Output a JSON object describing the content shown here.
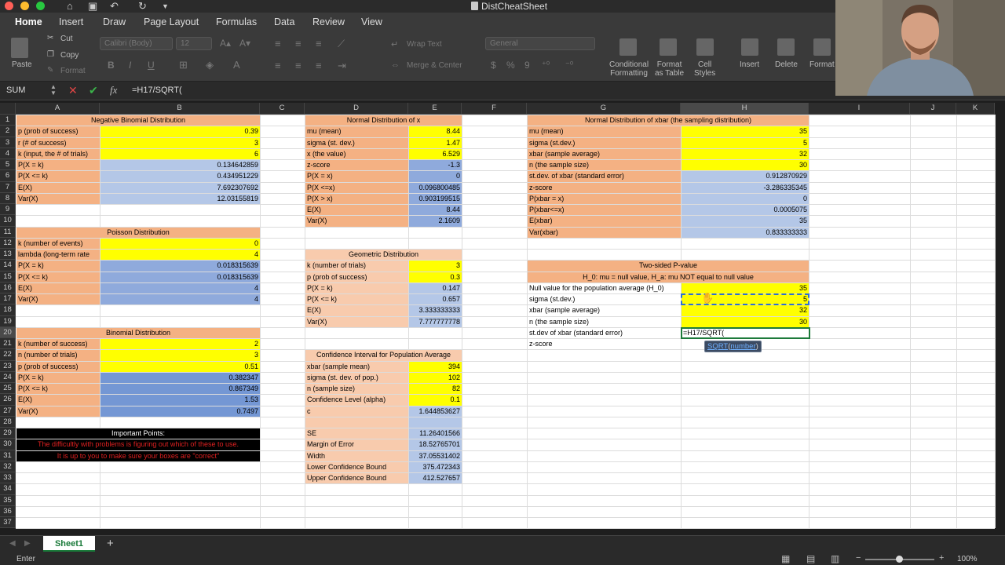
{
  "window": {
    "title": "DistCheatSheet"
  },
  "ribbon_tabs": [
    "Home",
    "Insert",
    "Draw",
    "Page Layout",
    "Formulas",
    "Data",
    "Review",
    "View"
  ],
  "ribbon": {
    "paste": "Paste",
    "cut": "Cut",
    "copy": "Copy",
    "format": "Format",
    "font_name": "Calibri (Body)",
    "font_size": "12",
    "wrap_text": "Wrap Text",
    "merge_center": "Merge & Center",
    "number_format": "General",
    "currency": "$",
    "percent": "%",
    "comma": "9",
    "cond_format": [
      "Conditional",
      "Formatting"
    ],
    "format_table": [
      "Format",
      "as Table"
    ],
    "cell_styles": [
      "Cell",
      "Styles"
    ],
    "insert": "Insert",
    "delete": "Delete",
    "format2": "Format"
  },
  "formula_bar": {
    "name_box": "SUM",
    "fx": "fx",
    "formula": "=H17/SQRT("
  },
  "columns": [
    "A",
    "B",
    "C",
    "D",
    "E",
    "F",
    "G",
    "H",
    "I",
    "J",
    "K"
  ],
  "rows": [
    "1",
    "2",
    "3",
    "4",
    "5",
    "6",
    "7",
    "8",
    "9",
    "10",
    "11",
    "12",
    "13",
    "14",
    "15",
    "16",
    "17",
    "18",
    "19",
    "20",
    "21",
    "22",
    "23",
    "24",
    "25",
    "26",
    "27",
    "28",
    "29",
    "30",
    "31",
    "32",
    "33",
    "34",
    "35",
    "36",
    "37"
  ],
  "cells": [
    {
      "c": "A",
      "c2": "B",
      "r": 1,
      "t": "Negative Binomial Distribution",
      "bg": "#f4b183",
      "al": "c"
    },
    {
      "c": "A",
      "r": 2,
      "t": "p (prob of success)",
      "bg": "#f4b183"
    },
    {
      "c": "B",
      "r": 2,
      "t": "0.39",
      "bg": "#ffff00",
      "al": "r"
    },
    {
      "c": "A",
      "r": 3,
      "t": "r (# of success)",
      "bg": "#f4b183"
    },
    {
      "c": "B",
      "r": 3,
      "t": "3",
      "bg": "#ffff00",
      "al": "r"
    },
    {
      "c": "A",
      "r": 4,
      "t": "k (input, the # of trials)",
      "bg": "#f4b183"
    },
    {
      "c": "B",
      "r": 4,
      "t": "6",
      "bg": "#ffff00",
      "al": "r"
    },
    {
      "c": "A",
      "r": 5,
      "t": "P(X = k)",
      "bg": "#f4b183"
    },
    {
      "c": "B",
      "r": 5,
      "t": "0.134642859",
      "bg": "#b4c7e7",
      "al": "r"
    },
    {
      "c": "A",
      "r": 6,
      "t": "P(X <= k)",
      "bg": "#f4b183"
    },
    {
      "c": "B",
      "r": 6,
      "t": "0.434951229",
      "bg": "#b4c7e7",
      "al": "r"
    },
    {
      "c": "A",
      "r": 7,
      "t": "E(X)",
      "bg": "#f4b183"
    },
    {
      "c": "B",
      "r": 7,
      "t": "7.692307692",
      "bg": "#b4c7e7",
      "al": "r"
    },
    {
      "c": "A",
      "r": 8,
      "t": "Var(X)",
      "bg": "#f4b183"
    },
    {
      "c": "B",
      "r": 8,
      "t": "12.03155819",
      "bg": "#b4c7e7",
      "al": "r"
    },
    {
      "c": "A",
      "c2": "B",
      "r": 11,
      "t": "Poisson Distribution",
      "bg": "#f4b183",
      "al": "c"
    },
    {
      "c": "A",
      "r": 12,
      "t": "k (number of events)",
      "bg": "#f4b183"
    },
    {
      "c": "B",
      "r": 12,
      "t": "0",
      "bg": "#ffff00",
      "al": "r"
    },
    {
      "c": "A",
      "r": 13,
      "t": "lambda (long-term rate",
      "bg": "#f4b183"
    },
    {
      "c": "B",
      "r": 13,
      "t": "4",
      "bg": "#ffff00",
      "al": "r"
    },
    {
      "c": "A",
      "r": 14,
      "t": "P(X = k)",
      "bg": "#f4b183"
    },
    {
      "c": "B",
      "r": 14,
      "t": "0.018315639",
      "bg": "#8faadc",
      "al": "r"
    },
    {
      "c": "A",
      "r": 15,
      "t": "P(X <= k)",
      "bg": "#f4b183"
    },
    {
      "c": "B",
      "r": 15,
      "t": "0.018315639",
      "bg": "#8faadc",
      "al": "r"
    },
    {
      "c": "A",
      "r": 16,
      "t": "E(X)",
      "bg": "#f4b183"
    },
    {
      "c": "B",
      "r": 16,
      "t": "4",
      "bg": "#8faadc",
      "al": "r"
    },
    {
      "c": "A",
      "r": 17,
      "t": "Var(X)",
      "bg": "#f4b183"
    },
    {
      "c": "B",
      "r": 17,
      "t": "4",
      "bg": "#8faadc",
      "al": "r"
    },
    {
      "c": "A",
      "c2": "B",
      "r": 20,
      "t": "Binomial Distribution",
      "bg": "#f4b183",
      "al": "c"
    },
    {
      "c": "A",
      "r": 21,
      "t": "k (number of success)",
      "bg": "#f4b183"
    },
    {
      "c": "B",
      "r": 21,
      "t": "2",
      "bg": "#ffff00",
      "al": "r"
    },
    {
      "c": "A",
      "r": 22,
      "t": "n (number of trials)",
      "bg": "#f4b183"
    },
    {
      "c": "B",
      "r": 22,
      "t": "3",
      "bg": "#ffff00",
      "al": "r"
    },
    {
      "c": "A",
      "r": 23,
      "t": "p (prob of success)",
      "bg": "#f4b183"
    },
    {
      "c": "B",
      "r": 23,
      "t": "0.51",
      "bg": "#ffff00",
      "al": "r"
    },
    {
      "c": "A",
      "r": 24,
      "t": "P(X = k)",
      "bg": "#f4b183"
    },
    {
      "c": "B",
      "r": 24,
      "t": "0.382347",
      "bg": "#7497d4",
      "al": "r"
    },
    {
      "c": "A",
      "r": 25,
      "t": "P(X <= k)",
      "bg": "#f4b183"
    },
    {
      "c": "B",
      "r": 25,
      "t": "0.867349",
      "bg": "#7497d4",
      "al": "r"
    },
    {
      "c": "A",
      "r": 26,
      "t": "E(X)",
      "bg": "#f4b183"
    },
    {
      "c": "B",
      "r": 26,
      "t": "1.53",
      "bg": "#7497d4",
      "al": "r"
    },
    {
      "c": "A",
      "r": 27,
      "t": "Var(X)",
      "bg": "#f4b183"
    },
    {
      "c": "B",
      "r": 27,
      "t": "0.7497",
      "bg": "#7497d4",
      "al": "r"
    },
    {
      "c": "A",
      "c2": "B",
      "r": 29,
      "t": "Important Points:",
      "bg": "#000000",
      "fg": "#ffffff",
      "al": "c"
    },
    {
      "c": "A",
      "c2": "B",
      "r": 30,
      "t": "The difficultly with problems is figuring out which of these to use.",
      "bg": "#000000",
      "fg": "#e02020",
      "al": "c"
    },
    {
      "c": "A",
      "c2": "B",
      "r": 31,
      "t": "It is up to you to make sure your boxes are \"correct\"",
      "bg": "#000000",
      "fg": "#e02020",
      "al": "c"
    },
    {
      "c": "D",
      "c2": "E",
      "r": 1,
      "t": "Normal Distribution of x",
      "bg": "#f4b183",
      "al": "c"
    },
    {
      "c": "D",
      "r": 2,
      "t": "mu (mean)",
      "bg": "#f4b183"
    },
    {
      "c": "E",
      "r": 2,
      "t": "8.44",
      "bg": "#ffff00",
      "al": "r"
    },
    {
      "c": "D",
      "r": 3,
      "t": "sigma (st. dev.)",
      "bg": "#f4b183"
    },
    {
      "c": "E",
      "r": 3,
      "t": "1.47",
      "bg": "#ffff00",
      "al": "r"
    },
    {
      "c": "D",
      "r": 4,
      "t": "x (the value)",
      "bg": "#f4b183"
    },
    {
      "c": "E",
      "r": 4,
      "t": "6.529",
      "bg": "#ffff00",
      "al": "r"
    },
    {
      "c": "D",
      "r": 5,
      "t": "z-score",
      "bg": "#f4b183"
    },
    {
      "c": "E",
      "r": 5,
      "t": "-1.3",
      "bg": "#8faadc",
      "al": "r"
    },
    {
      "c": "D",
      "r": 6,
      "t": "P(X = x)",
      "bg": "#f4b183"
    },
    {
      "c": "E",
      "r": 6,
      "t": "0",
      "bg": "#8faadc",
      "al": "r"
    },
    {
      "c": "D",
      "r": 7,
      "t": "P(X <=x)",
      "bg": "#f4b183"
    },
    {
      "c": "E",
      "r": 7,
      "t": "0.096800485",
      "bg": "#8faadc",
      "al": "r"
    },
    {
      "c": "D",
      "r": 8,
      "t": "P(X > x)",
      "bg": "#f4b183"
    },
    {
      "c": "E",
      "r": 8,
      "t": "0.903199515",
      "bg": "#8faadc",
      "al": "r"
    },
    {
      "c": "D",
      "r": 9,
      "t": "E(X)",
      "bg": "#f4b183"
    },
    {
      "c": "E",
      "r": 9,
      "t": "8.44",
      "bg": "#8faadc",
      "al": "r"
    },
    {
      "c": "D",
      "r": 10,
      "t": "Var(X)",
      "bg": "#f4b183"
    },
    {
      "c": "E",
      "r": 10,
      "t": "2.1609",
      "bg": "#8faadc",
      "al": "r"
    },
    {
      "c": "D",
      "c2": "E",
      "r": 13,
      "t": "Geometric Distribution",
      "bg": "#f8cbad",
      "al": "c"
    },
    {
      "c": "D",
      "r": 14,
      "t": "k (number of trials)",
      "bg": "#f8cbad"
    },
    {
      "c": "E",
      "r": 14,
      "t": "3",
      "bg": "#ffff00",
      "al": "r"
    },
    {
      "c": "D",
      "r": 15,
      "t": "p (prob of success)",
      "bg": "#f8cbad"
    },
    {
      "c": "E",
      "r": 15,
      "t": "0.3",
      "bg": "#ffff00",
      "al": "r"
    },
    {
      "c": "D",
      "r": 16,
      "t": "P(X = k)",
      "bg": "#f8cbad"
    },
    {
      "c": "E",
      "r": 16,
      "t": "0.147",
      "bg": "#b4c7e7",
      "al": "r"
    },
    {
      "c": "D",
      "r": 17,
      "t": "P(X <= k)",
      "bg": "#f8cbad"
    },
    {
      "c": "E",
      "r": 17,
      "t": "0.657",
      "bg": "#b4c7e7",
      "al": "r"
    },
    {
      "c": "D",
      "r": 18,
      "t": "E(X)",
      "bg": "#f8cbad"
    },
    {
      "c": "E",
      "r": 18,
      "t": "3.333333333",
      "bg": "#b4c7e7",
      "al": "r"
    },
    {
      "c": "D",
      "r": 19,
      "t": "Var(X)",
      "bg": "#f8cbad"
    },
    {
      "c": "E",
      "r": 19,
      "t": "7.777777778",
      "bg": "#b4c7e7",
      "al": "r"
    },
    {
      "c": "D",
      "c2": "E",
      "r": 22,
      "t": "Confidence Interval for Population Average",
      "bg": "#f8cbad",
      "al": "c"
    },
    {
      "c": "D",
      "r": 23,
      "t": "xbar (sample mean)",
      "bg": "#f8cbad"
    },
    {
      "c": "E",
      "r": 23,
      "t": "394",
      "bg": "#ffff00",
      "al": "r"
    },
    {
      "c": "D",
      "r": 24,
      "t": "sigma (st. dev. of pop.)",
      "bg": "#f8cbad"
    },
    {
      "c": "E",
      "r": 24,
      "t": "102",
      "bg": "#ffff00",
      "al": "r"
    },
    {
      "c": "D",
      "r": 25,
      "t": "n (sample size)",
      "bg": "#f8cbad"
    },
    {
      "c": "E",
      "r": 25,
      "t": "82",
      "bg": "#ffff00",
      "al": "r"
    },
    {
      "c": "D",
      "r": 26,
      "t": "Confidence Level (alpha)",
      "bg": "#f8cbad"
    },
    {
      "c": "E",
      "r": 26,
      "t": "0.1",
      "bg": "#ffff00",
      "al": "r"
    },
    {
      "c": "D",
      "r": 27,
      "t": "c",
      "bg": "#f8cbad"
    },
    {
      "c": "E",
      "r": 27,
      "t": "1.644853627",
      "bg": "#b4c7e7",
      "al": "r"
    },
    {
      "c": "D",
      "r": 28,
      "t": "",
      "bg": "#f8cbad"
    },
    {
      "c": "E",
      "r": 28,
      "t": "",
      "bg": "#b4c7e7",
      "al": "r"
    },
    {
      "c": "D",
      "r": 29,
      "t": "SE",
      "bg": "#f8cbad"
    },
    {
      "c": "E",
      "r": 29,
      "t": "11.26401566",
      "bg": "#b4c7e7",
      "al": "r"
    },
    {
      "c": "D",
      "r": 30,
      "t": "Margin of Error",
      "bg": "#f8cbad"
    },
    {
      "c": "E",
      "r": 30,
      "t": "18.52765701",
      "bg": "#b4c7e7",
      "al": "r"
    },
    {
      "c": "D",
      "r": 31,
      "t": "Width",
      "bg": "#f8cbad"
    },
    {
      "c": "E",
      "r": 31,
      "t": "37.05531402",
      "bg": "#b4c7e7",
      "al": "r"
    },
    {
      "c": "D",
      "r": 32,
      "t": "Lower Confidence Bound",
      "bg": "#f8cbad"
    },
    {
      "c": "E",
      "r": 32,
      "t": "375.472343",
      "bg": "#b4c7e7",
      "al": "r"
    },
    {
      "c": "D",
      "r": 33,
      "t": "Upper Confidence Bound",
      "bg": "#f8cbad"
    },
    {
      "c": "E",
      "r": 33,
      "t": "412.527657",
      "bg": "#b4c7e7",
      "al": "r"
    },
    {
      "c": "G",
      "c2": "H",
      "r": 1,
      "t": "Normal Distribution of xbar (the sampling distribution)",
      "bg": "#f4b183",
      "al": "c"
    },
    {
      "c": "G",
      "r": 2,
      "t": "mu (mean)",
      "bg": "#f4b183"
    },
    {
      "c": "H",
      "r": 2,
      "t": "35",
      "bg": "#ffff00",
      "al": "r"
    },
    {
      "c": "G",
      "r": 3,
      "t": "sigma (st.dev.)",
      "bg": "#f4b183"
    },
    {
      "c": "H",
      "r": 3,
      "t": "5",
      "bg": "#ffff00",
      "al": "r"
    },
    {
      "c": "G",
      "r": 4,
      "t": "xbar (sample average)",
      "bg": "#f4b183"
    },
    {
      "c": "H",
      "r": 4,
      "t": "32",
      "bg": "#ffff00",
      "al": "r"
    },
    {
      "c": "G",
      "r": 5,
      "t": "n (the sample size)",
      "bg": "#f4b183"
    },
    {
      "c": "H",
      "r": 5,
      "t": "30",
      "bg": "#ffff00",
      "al": "r"
    },
    {
      "c": "G",
      "r": 6,
      "t": "st.dev. of xbar (standard error)",
      "bg": "#f4b183"
    },
    {
      "c": "H",
      "r": 6,
      "t": "0.912870929",
      "bg": "#b4c7e7",
      "al": "r"
    },
    {
      "c": "G",
      "r": 7,
      "t": "z-score",
      "bg": "#f4b183"
    },
    {
      "c": "H",
      "r": 7,
      "t": "-3.286335345",
      "bg": "#b4c7e7",
      "al": "r"
    },
    {
      "c": "G",
      "r": 8,
      "t": "P(xbar = x)",
      "bg": "#f4b183"
    },
    {
      "c": "H",
      "r": 8,
      "t": "0",
      "bg": "#b4c7e7",
      "al": "r"
    },
    {
      "c": "G",
      "r": 9,
      "t": "P(xbar<=x)",
      "bg": "#f4b183"
    },
    {
      "c": "H",
      "r": 9,
      "t": "0.0005075",
      "bg": "#b4c7e7",
      "al": "r"
    },
    {
      "c": "G",
      "r": 10,
      "t": "E(xbar)",
      "bg": "#f4b183"
    },
    {
      "c": "H",
      "r": 10,
      "t": "35",
      "bg": "#b4c7e7",
      "al": "r"
    },
    {
      "c": "G",
      "r": 11,
      "t": "Var(xbar)",
      "bg": "#f4b183"
    },
    {
      "c": "H",
      "r": 11,
      "t": "0.833333333",
      "bg": "#b4c7e7",
      "al": "r"
    },
    {
      "c": "G",
      "c2": "H",
      "r": 14,
      "t": "Two-sided P-value",
      "bg": "#f4b183",
      "al": "c"
    },
    {
      "c": "G",
      "c2": "H",
      "r": 15,
      "t": "H_0: mu = null value, H_a: mu NOT equal to null value",
      "bg": "#f4b183",
      "al": "c"
    },
    {
      "c": "G",
      "r": 16,
      "t": "Null value for the population average (H_0)",
      "bg": "#ffffff"
    },
    {
      "c": "H",
      "r": 16,
      "t": "35",
      "bg": "#ffff00",
      "al": "r"
    },
    {
      "c": "G",
      "r": 17,
      "t": "sigma (st.dev.)",
      "bg": "#ffffff"
    },
    {
      "c": "H",
      "r": 17,
      "t": "5",
      "bg": "#ffff00",
      "al": "r"
    },
    {
      "c": "G",
      "r": 18,
      "t": "xbar (sample average)",
      "bg": "#ffffff"
    },
    {
      "c": "H",
      "r": 18,
      "t": "32",
      "bg": "#ffff00",
      "al": "r"
    },
    {
      "c": "G",
      "r": 19,
      "t": "n (the sample size)",
      "bg": "#ffffff"
    },
    {
      "c": "H",
      "r": 19,
      "t": "30",
      "bg": "#ffff00",
      "al": "r"
    },
    {
      "c": "G",
      "r": 20,
      "t": "st.dev of xbar (standard error)",
      "bg": "#ffffff"
    },
    {
      "c": "G",
      "r": 21,
      "t": "z-score",
      "bg": "#ffffff"
    }
  ],
  "editing": {
    "text": "=H17/SQRT("
  },
  "tooltip": {
    "fn": "SQRT",
    "arg": "number"
  },
  "sheet": {
    "name": "Sheet1",
    "add": "+"
  },
  "status": {
    "mode": "Enter",
    "zoom": "100%"
  }
}
